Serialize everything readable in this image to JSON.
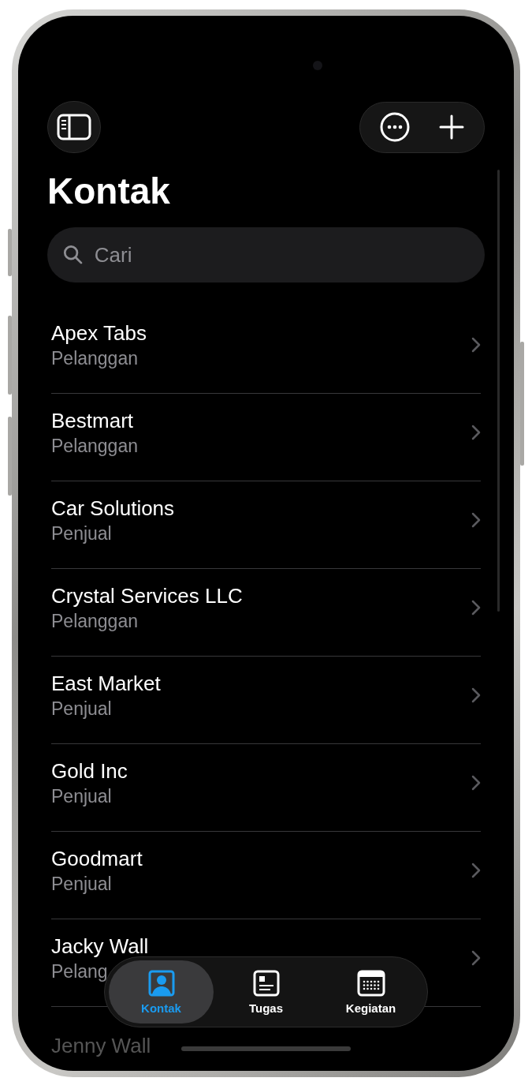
{
  "title": "Kontak",
  "search": {
    "placeholder": "Cari"
  },
  "contacts": [
    {
      "name": "Apex Tabs",
      "type": "Pelanggan",
      "dimmed": false
    },
    {
      "name": "Bestmart",
      "type": "Pelanggan",
      "dimmed": false
    },
    {
      "name": "Car Solutions",
      "type": "Penjual",
      "dimmed": false
    },
    {
      "name": "Crystal Services LLC",
      "type": "Pelanggan",
      "dimmed": false
    },
    {
      "name": "East Market",
      "type": "Penjual",
      "dimmed": false
    },
    {
      "name": "Gold Inc",
      "type": "Penjual",
      "dimmed": false
    },
    {
      "name": "Goodmart",
      "type": "Penjual",
      "dimmed": false
    },
    {
      "name": "Jacky Wall",
      "type": "Pelang",
      "dimmed": false
    },
    {
      "name": "Jenny Wall",
      "dimmed": true
    }
  ],
  "tabs": [
    {
      "label": "Kontak",
      "kind": "person",
      "selected": true
    },
    {
      "label": "Tugas",
      "kind": "card",
      "selected": false
    },
    {
      "label": "Kegiatan",
      "kind": "calendar",
      "selected": false
    }
  ]
}
